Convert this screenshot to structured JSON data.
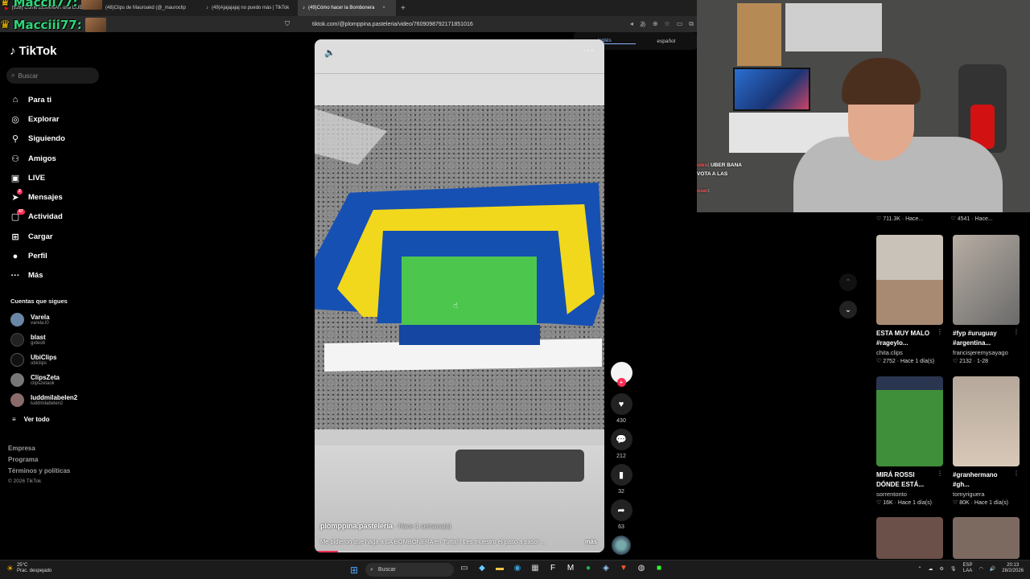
{
  "browser": {
    "tabs": [
      {
        "label": "(928) Cómo ELIMINAR una CUENTA",
        "active": false
      },
      {
        "label": "(48)Clips de Mauroakd (@_mauroclip",
        "active": false
      },
      {
        "label": "(49)Ajajajajaj no puedo más | TikTok",
        "active": false
      },
      {
        "label": "(49)Cómo hacer la Bombonera",
        "active": true
      }
    ],
    "new_tab": "+",
    "url": "tiktok.com/@plomppina.pasteleria/video/7609098792171851016",
    "translate_popup": {
      "lang1": "inglés",
      "lang2": "español"
    }
  },
  "overlay": {
    "name1": "Maccii77:",
    "name2": "Macciii77:"
  },
  "sidebar": {
    "logo": "TikTok",
    "search_placeholder": "Buscar",
    "nav": [
      {
        "label": "Para ti",
        "icon": "home-icon"
      },
      {
        "label": "Explorar",
        "icon": "compass-icon"
      },
      {
        "label": "Siguiendo",
        "icon": "following-icon"
      },
      {
        "label": "Amigos",
        "icon": "friends-icon"
      },
      {
        "label": "LIVE",
        "icon": "live-icon"
      },
      {
        "label": "Mensajes",
        "icon": "messages-icon",
        "badge": "2"
      },
      {
        "label": "Actividad",
        "icon": "activity-icon",
        "badge": "47"
      },
      {
        "label": "Cargar",
        "icon": "upload-icon"
      },
      {
        "label": "Perfil",
        "icon": "profile-icon"
      },
      {
        "label": "Más",
        "icon": "more-icon"
      }
    ],
    "following_title": "Cuentas que sigues",
    "following": [
      {
        "name": "Varela",
        "handle": "varela.l0"
      },
      {
        "name": "blast",
        "handle": "gxteo8"
      },
      {
        "name": "UbiClips",
        "handle": "ubiclips"
      },
      {
        "name": "ClipsZeta",
        "handle": "clipszetaok"
      },
      {
        "name": "luddmilabelen2",
        "handle": "luddmilabelen2"
      }
    ],
    "see_all": "Ver todo",
    "footer": [
      "Empresa",
      "Programa",
      "Términos y políticas"
    ],
    "copyright": "© 2026 TikTok"
  },
  "video": {
    "author": "plomppina.pasteleria",
    "time": " · Hace 1 semana(s)",
    "description": "Me pidieron que haga a LA BOMBONERA en Torta!!! Les muestro el paso a paso! ...",
    "more": "más",
    "progress": 0.08,
    "likes": "430",
    "comments": "212",
    "saves": "32",
    "shares": "63"
  },
  "webcam_chat": {
    "line1_a": "ules",
    "line1_b": ": UBER BANA",
    "line2": "VOTA A LAS",
    "line3_a": "oser",
    "line3_b": ":"
  },
  "recommendations": {
    "top_meta": [
      "♡ 711.3K · Hace...",
      "♡ 4541 · Hace..."
    ],
    "items": [
      {
        "title": "ESTA MUY MALO #rageylo...",
        "author": "chita.clips",
        "meta": "♡ 2752 · Hace 1 día(s)",
        "thumb": "#8a7a6a"
      },
      {
        "title": "#fyp #uruguay #argentina...",
        "author": "francisjeremysayago",
        "meta": "♡ 2132 · 1-28",
        "thumb": "#9a8f86"
      },
      {
        "title": "MIRÁ ROSSI DÓNDE ESTÁ...",
        "author": "sorrentonto",
        "meta": "♡ 16K · Hace 1 día(s)",
        "thumb": "#3a8a3a"
      },
      {
        "title": "#granhermano #gh...",
        "author": "tomyriguera",
        "meta": "♡ 80K · Hace 1 día(s)",
        "thumb": "#a89c8e"
      }
    ]
  },
  "taskbar": {
    "temp": "25°C",
    "weather": "Prac. despejado",
    "search": "Buscar",
    "lang1": "ESP",
    "lang2": "LAA",
    "time": "20:13",
    "date": "28/2/2026"
  }
}
